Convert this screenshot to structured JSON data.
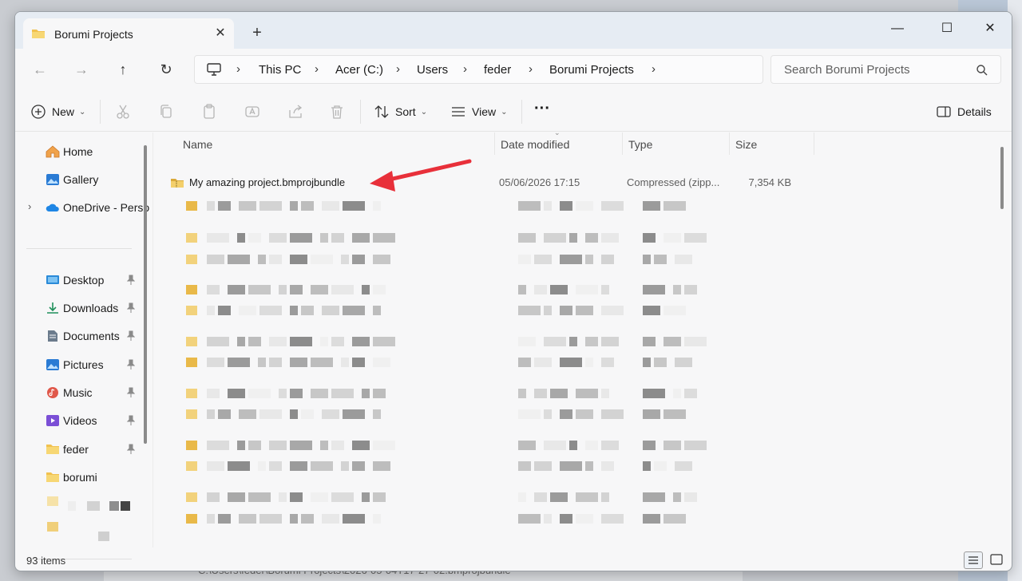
{
  "window": {
    "tab_title": "Borumi Projects",
    "close_tab": "✕",
    "new_tab": "+",
    "min": "—",
    "max": "☐",
    "close": "✕"
  },
  "nav": {
    "back": "←",
    "forward": "→",
    "up": "↑",
    "refresh": "↻"
  },
  "breadcrumb": [
    "This PC",
    "Acer (C:)",
    "Users",
    "feder",
    "Borumi Projects"
  ],
  "search": {
    "placeholder": "Search Borumi Projects"
  },
  "toolbar": {
    "new_label": "New",
    "sort_label": "Sort",
    "view_label": "View",
    "more_label": "···",
    "details_label": "Details",
    "action_icons": [
      "cut-icon",
      "copy-icon",
      "paste-icon",
      "rename-icon",
      "share-icon",
      "delete-icon"
    ]
  },
  "sidebar": {
    "top_items": [
      {
        "label": "Home",
        "icon": "home-icon"
      },
      {
        "label": "Gallery",
        "icon": "gallery-icon"
      },
      {
        "label": "OneDrive - Perso",
        "icon": "onedrive-icon"
      }
    ],
    "quick_access": [
      {
        "label": "Desktop",
        "icon": "desktop-icon",
        "pinned": true
      },
      {
        "label": "Downloads",
        "icon": "downloads-icon",
        "pinned": true
      },
      {
        "label": "Documents",
        "icon": "documents-icon",
        "pinned": true
      },
      {
        "label": "Pictures",
        "icon": "pictures-icon",
        "pinned": true
      },
      {
        "label": "Music",
        "icon": "music-icon",
        "pinned": true
      },
      {
        "label": "Videos",
        "icon": "videos-icon",
        "pinned": true
      },
      {
        "label": "feder",
        "icon": "folder-icon",
        "pinned": true
      },
      {
        "label": "borumi",
        "icon": "folder-icon",
        "pinned": false
      }
    ]
  },
  "columns": {
    "name": "Name",
    "date": "Date modified",
    "type": "Type",
    "size": "Size"
  },
  "files": [
    {
      "name": "My amazing project.bmprojbundle",
      "date": "05/06/2026 17:15",
      "type": "Compressed (zipp...",
      "size": "7,354 KB"
    }
  ],
  "status": {
    "item_count": "93 items"
  },
  "background": {
    "behind_text": "C:\\Users\\feder\\Borumi Projects\\2026-05-04T17-27-02.bmprojbundle"
  },
  "colors": {
    "folder": "#e8b84a",
    "arrow": "#e8303a",
    "accent": "#0067c0"
  }
}
